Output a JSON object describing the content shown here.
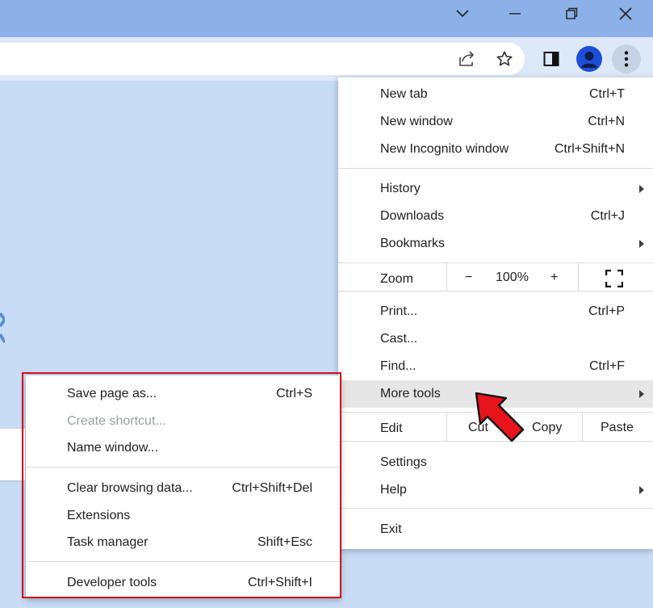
{
  "window_controls": {
    "tab_search_icon": "chevron-down-icon",
    "minimize_icon": "minimize-icon",
    "restore_icon": "restore-icon",
    "close_icon": "close-icon"
  },
  "toolbar": {
    "icons": [
      "share-icon",
      "bookmark-star-icon",
      "side-panel-icon",
      "profile-avatar-icon",
      "more-menu-icon"
    ]
  },
  "menu": {
    "group1": [
      {
        "label": "New tab",
        "shortcut": "Ctrl+T"
      },
      {
        "label": "New window",
        "shortcut": "Ctrl+N"
      },
      {
        "label": "New Incognito window",
        "shortcut": "Ctrl+Shift+N"
      }
    ],
    "group2": [
      {
        "label": "History",
        "shortcut": ""
      },
      {
        "label": "Downloads",
        "shortcut": "Ctrl+J"
      },
      {
        "label": "Bookmarks",
        "shortcut": ""
      }
    ],
    "zoom": {
      "label": "Zoom",
      "minus": "−",
      "value": "100%",
      "plus": "+"
    },
    "group3": [
      {
        "label": "Print...",
        "shortcut": "Ctrl+P"
      },
      {
        "label": "Cast...",
        "shortcut": ""
      },
      {
        "label": "Find...",
        "shortcut": "Ctrl+F"
      },
      {
        "label": "More tools",
        "shortcut": ""
      }
    ],
    "edit": {
      "label": "Edit",
      "cut": "Cut",
      "copy": "Copy",
      "paste": "Paste"
    },
    "group4": [
      {
        "label": "Settings"
      },
      {
        "label": "Help"
      }
    ],
    "exit": "Exit"
  },
  "submenu": {
    "group1": [
      {
        "label": "Save page as...",
        "shortcut": "Ctrl+S"
      },
      {
        "label": "Create shortcut...",
        "shortcut": ""
      },
      {
        "label": "Name window...",
        "shortcut": ""
      }
    ],
    "group2": [
      {
        "label": "Clear browsing data...",
        "shortcut": "Ctrl+Shift+Del"
      },
      {
        "label": "Extensions",
        "shortcut": ""
      },
      {
        "label": "Task manager",
        "shortcut": "Shift+Esc"
      }
    ],
    "group3": [
      {
        "label": "Developer tools",
        "shortcut": "Ctrl+Shift+I"
      }
    ]
  },
  "colors": {
    "titlebar": "#8bb1e8",
    "toolbar": "#dde8f8",
    "page_bg": "#c9dcf5",
    "highlight": "#e6e6e6",
    "annotation_red": "#d0101a"
  }
}
